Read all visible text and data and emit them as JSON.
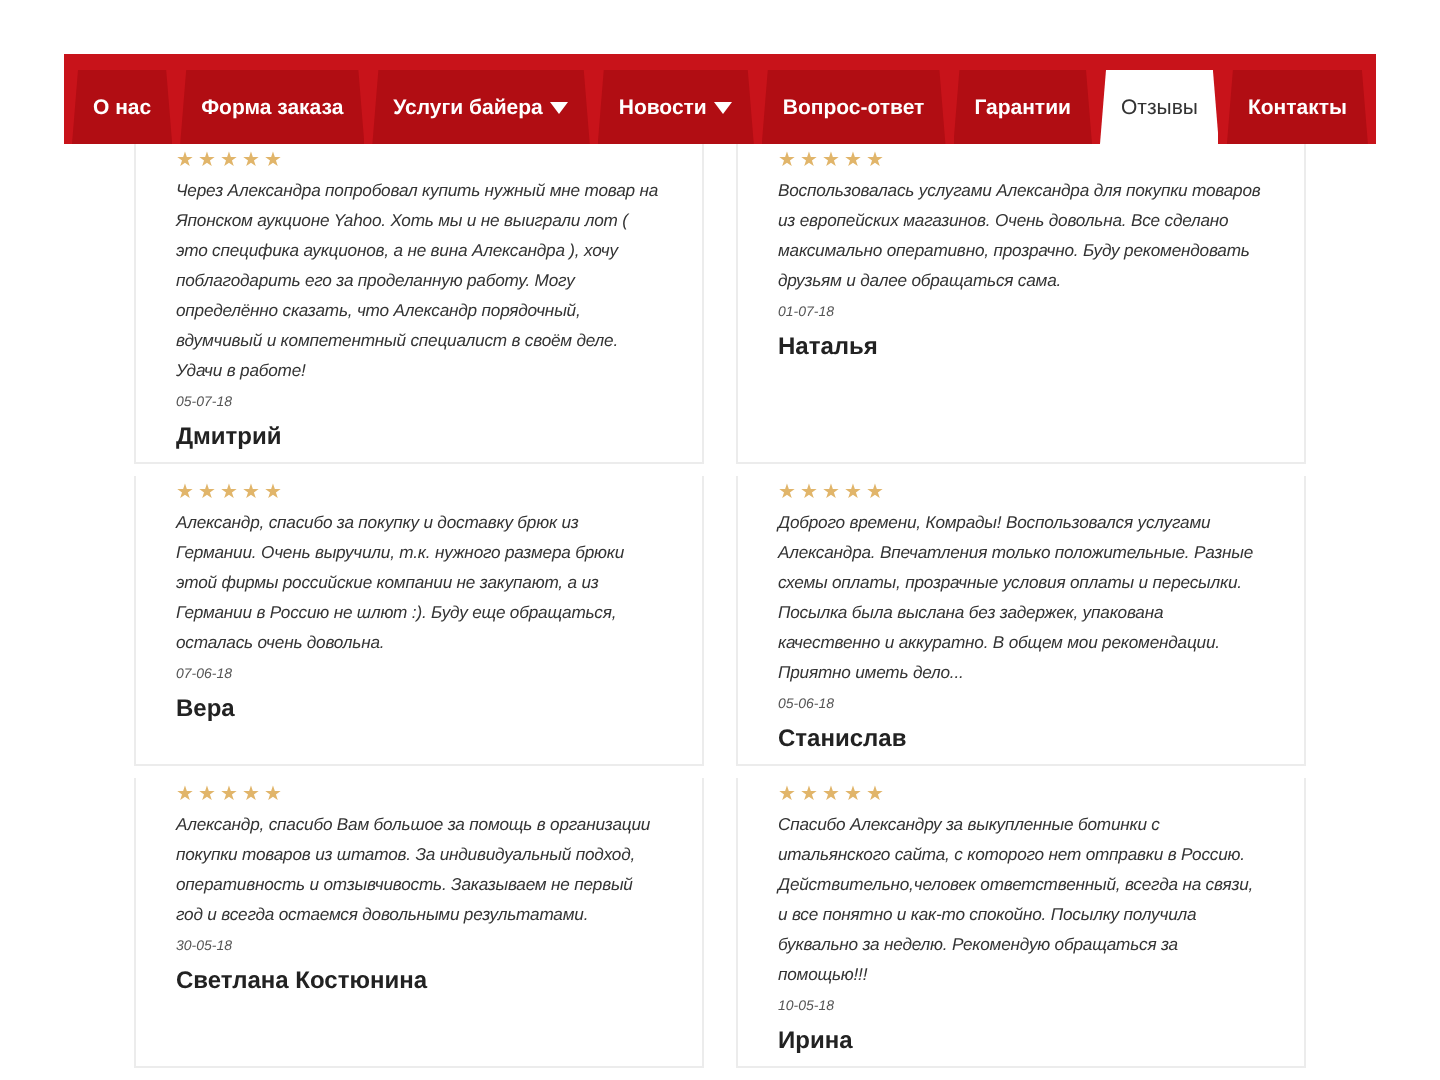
{
  "nav": [
    {
      "label": "О нас",
      "selected": false,
      "dropdown": false
    },
    {
      "label": "Форма заказа",
      "selected": false,
      "dropdown": false
    },
    {
      "label": "Услуги байера",
      "selected": false,
      "dropdown": true
    },
    {
      "label": "Новости",
      "selected": false,
      "dropdown": true
    },
    {
      "label": "Вопрос-ответ",
      "selected": false,
      "dropdown": false
    },
    {
      "label": "Гарантии",
      "selected": false,
      "dropdown": false
    },
    {
      "label": "Отзывы",
      "selected": true,
      "dropdown": false
    },
    {
      "label": "Контакты",
      "selected": false,
      "dropdown": false
    }
  ],
  "reviews": [
    {
      "stars": 5,
      "text": "Через Александра попробовал купить нужный мне товар на Японском аукционе Yahoo. Хоть мы и не выиграли лот ( это специфика аукционов, а не вина Александра ), хочу поблагодарить его за проделанную работу. Могу определённо сказать, что Александр порядочный, вдумчивый и компетентный специалист в своём деле. Удачи в работе!",
      "date": "05-07-18",
      "author": "Дмитрий"
    },
    {
      "stars": 5,
      "text": "Воспользовалась услугами Александра для покупки товаров из европейских магазинов. Очень довольна. Все сделано максимально оперативно, прозрачно. Буду рекомендовать друзьям и далее обращаться сама.",
      "date": "01-07-18",
      "author": "Наталья"
    },
    {
      "stars": 5,
      "text": "Александр, спасибо за покупку и доставку брюк из Германии. Очень выручили, т.к. нужного размера брюки этой фирмы российские компании не закупают, а из Германии в Россию не шлют :). Буду еще обращаться, осталась очень довольна.",
      "date": "07-06-18",
      "author": "Вера"
    },
    {
      "stars": 5,
      "text": "Доброго времени, Комрады! Воспользовался услугами Александра. Впечатления только положительные. Разные схемы оплаты, прозрачные условия оплаты и пересылки. Посылка была выслана без задержек, упакована качественно и аккуратно. В общем мои рекомендации. Приятно иметь дело...",
      "date": "05-06-18",
      "author": "Станислав"
    },
    {
      "stars": 5,
      "text": "Александр, спасибо Вам большое за помощь в организации покупки товаров из штатов. За индивидуальный подход, оперативность и отзывчивость. Заказываем не первый год и всегда остаемся довольными результатами.",
      "date": "30-05-18",
      "author": "Светлана Костюнина"
    },
    {
      "stars": 5,
      "text": "Спасибо Александру за выкупленные ботинки с итальянского сайта, с которого нет отправки в Россию. Действительно,человек ответственный, всегда на связи, и все понятно и как-то спокойно. Посылку получила буквально за неделю. Рекомендую обращаться за помощью!!!",
      "date": "10-05-18",
      "author": "Ирина"
    }
  ]
}
